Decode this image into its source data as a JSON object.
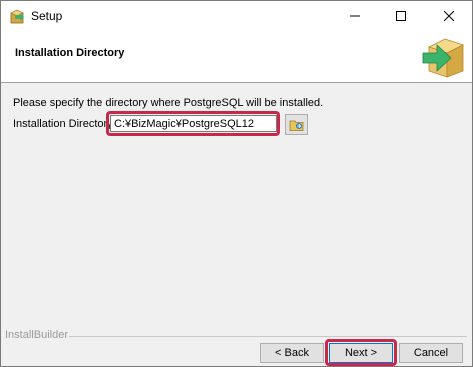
{
  "window": {
    "title": "Setup",
    "icon": "installer-icon"
  },
  "header": {
    "title": "Installation Directory",
    "logo": "box-arrow-logo"
  },
  "body": {
    "intro": "Please specify the directory where PostgreSQL will be installed.",
    "dir_label": "Installation Directory",
    "dir_value": "C:¥BizMagic¥PostgreSQL12",
    "browse_icon": "folder-browse-icon"
  },
  "footer": {
    "builder": "InstallBuilder",
    "back_label": "< Back",
    "next_label": "Next >",
    "cancel_label": "Cancel"
  },
  "colors": {
    "highlight": "#c8284a",
    "logo_box": "#e9c46a",
    "logo_arrow": "#3bb36a"
  }
}
